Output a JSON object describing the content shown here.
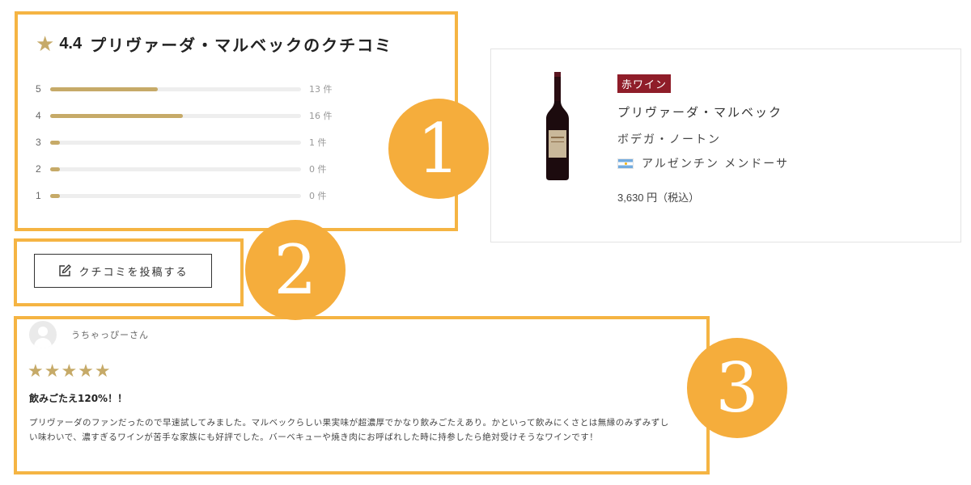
{
  "rating": {
    "star_icon": "★",
    "score": "4.4",
    "title": "プリヴァーダ・マルベックのクチコミ",
    "distribution": [
      {
        "stars": "5",
        "count": "13 件",
        "fraction": 0.43
      },
      {
        "stars": "4",
        "count": "16 件",
        "fraction": 0.53
      },
      {
        "stars": "3",
        "count": "1 件",
        "fraction": 0.04
      },
      {
        "stars": "2",
        "count": "0 件",
        "fraction": 0.04
      },
      {
        "stars": "1",
        "count": "0 件",
        "fraction": 0.04
      }
    ]
  },
  "product": {
    "type_badge": "赤ワイン",
    "name": "プリヴァーダ・マルベック",
    "producer": "ボデガ・ノートン",
    "origin": "アルゼンチン メンドーサ",
    "flag_icon": "argentina-flag-icon",
    "price": "3,630 円（税込）"
  },
  "post_button": {
    "label": "クチコミを投稿する",
    "icon": "edit-icon"
  },
  "review": {
    "reviewer": "うちゃっぴーさん",
    "stars": "★★★★★",
    "title": "飲みごたえ120%！！",
    "body": "プリヴァーダのファンだったので早速試してみました。マルベックらしい果実味が超濃厚でかなり飲みごたえあり。かといって飲みにくさとは無縁のみずみずしい味わいで、濃すぎるワインが苦手な家族にも好評でした。バーベキューや焼き肉にお呼ばれした時に持参したら絶対受けそうなワインです！"
  },
  "annotations": {
    "badge_1": "1",
    "badge_2": "2",
    "badge_3": "3"
  },
  "colors": {
    "annotation_orange": "#f5ad3c",
    "rating_gold": "#c6aa68",
    "red_wine_badge": "#8f1d29"
  }
}
